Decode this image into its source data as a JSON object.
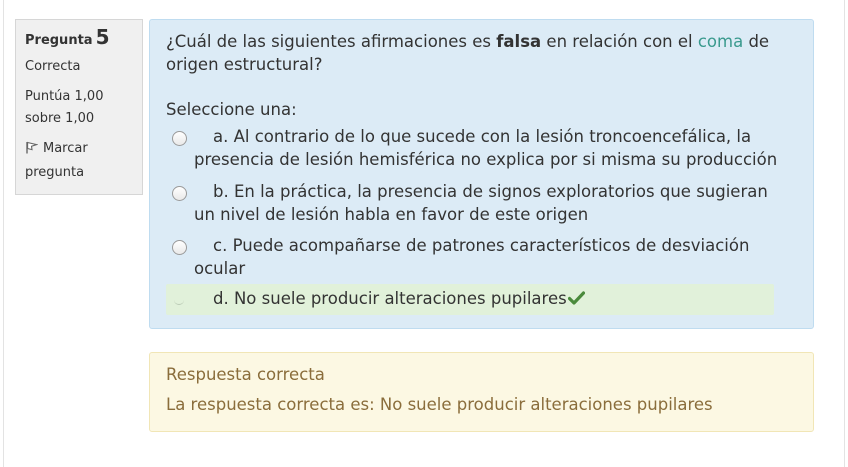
{
  "info": {
    "question_label": "Pregunta",
    "question_number": "5",
    "state": "Correcta",
    "grade_line1": "Puntúa 1,00",
    "grade_line2": "sobre 1,00",
    "flag_label_line1": "Marcar",
    "flag_label_line2": "pregunta"
  },
  "question": {
    "text_before": "¿Cuál de las siguientes afirmaciones es ",
    "text_bold": "falsa",
    "text_middle": " en relación con el ",
    "text_link": "coma",
    "text_after": " de origen estructural?",
    "prompt": "Seleccione una:",
    "options": [
      {
        "letter": "a.",
        "text": "Al contrario de lo que sucede con la lesión troncoencefálica, la presencia de lesión hemisférica no explica por si misma su producción",
        "selected": false
      },
      {
        "letter": "b.",
        "text": "En la práctica, la presencia de signos exploratorios que sugieran un nivel de lesión habla en favor de este origen",
        "selected": false
      },
      {
        "letter": "c.",
        "text": "Puede acompañarse de patrones característicos de desviación ocular",
        "selected": false
      },
      {
        "letter": "d.",
        "text": "No suele producir alteraciones pupilares",
        "selected": true
      }
    ]
  },
  "feedback": {
    "heading": "Respuesta correcta",
    "answer": "La respuesta correcta es: No suele producir alteraciones pupilares"
  },
  "colors": {
    "formulation_bg": "#dcebf6",
    "correct_bg": "#e1f1da",
    "feedback_bg": "#fcf8e3",
    "feedback_text": "#8a6d3b",
    "check": "#4a8a3c",
    "link": "#3a9a8e"
  }
}
